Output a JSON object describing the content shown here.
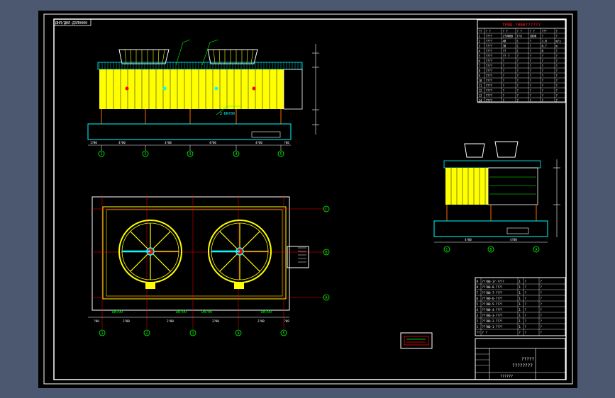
{
  "drawing": {
    "title_tag": "ДНЛ/ДНЛ-ДЗЛ0000",
    "colors": {
      "frame_bg": "#4c5870",
      "canvas_bg": "#000000",
      "fill": "#ffff00",
      "line": "#ffffff",
      "accent_cyan": "#00ffff",
      "accent_green": "#00ff00",
      "accent_red": "#ff0000",
      "accent_magenta": "#ff00ff"
    }
  },
  "spec_table": {
    "title": "TFNG-?000??????",
    "rows": [
      [
        "??",
        "? ?",
        "? ?",
        "? ?",
        "? ?",
        "???",
        "?"
      ],
      [
        "1",
        "????",
        "2?0000",
        "T/h",
        "1800",
        "?",
        "?"
      ],
      [
        "2",
        "????",
        "40",
        "C",
        "?",
        "3.8",
        "m/s"
      ],
      [
        "3",
        "????",
        "30",
        "C",
        "?",
        "0.?",
        "m"
      ],
      [
        "4",
        "????",
        "??",
        "C",
        "?",
        "0",
        "?"
      ],
      [
        "5",
        "????",
        "?? ?",
        "?",
        "?",
        "?",
        "?"
      ],
      [
        "6",
        "????",
        "?",
        "?",
        "?",
        "?",
        "?"
      ],
      [
        "7",
        "????",
        "?",
        "?",
        "?",
        "?",
        "?"
      ],
      [
        "8",
        "????",
        "?",
        "?",
        "?",
        "?",
        "?"
      ],
      [
        "9",
        "????",
        "?",
        "?",
        "?",
        "?",
        "?"
      ],
      [
        "10",
        "????",
        "?",
        "?",
        "?",
        "?",
        "?"
      ],
      [
        "11",
        "????",
        "?",
        "?",
        "?",
        "?",
        "?"
      ],
      [
        "12",
        "????",
        "?",
        "?",
        "?",
        "?",
        "?"
      ],
      [
        "13",
        "????",
        "?",
        "?",
        "?",
        "?",
        "?"
      ],
      [
        "14",
        "????",
        "?",
        "?",
        "?",
        "?",
        "?"
      ]
    ]
  },
  "front_view": {
    "bottom_dims": [
      "1?00",
      "4?00",
      "4?00",
      "4?00",
      "4?00",
      "?00"
    ],
    "axis_labels": [
      "1",
      "2",
      "3",
      "4",
      "5"
    ],
    "leader_text": "2-DN?00"
  },
  "plan_view": {
    "pipe_labels": [
      "DN?00",
      "DN?00",
      "DN?00",
      "DN?00"
    ],
    "bottom_dims": [
      "?00",
      "2?00",
      "2?00",
      "2?00",
      "2?00",
      "?00"
    ],
    "axis_labels": [
      "1",
      "2",
      "3",
      "4",
      "5"
    ],
    "row_labels": [
      "C",
      "B",
      "A"
    ]
  },
  "side_view": {
    "axis_labels": [
      "C",
      "B",
      "A"
    ],
    "dims": [
      "4?00",
      "4?00"
    ]
  },
  "parts_list": {
    "rows": [
      [
        "9",
        "???00-1?-????",
        "1",
        "?",
        "?"
      ],
      [
        "8",
        "???00-8-????",
        "1",
        "?",
        "?"
      ],
      [
        "7",
        "???00-7-????",
        "1",
        "?",
        "?"
      ],
      [
        "6",
        "???00-6-????",
        "1",
        "?",
        "?"
      ],
      [
        "5",
        "???00-5-????",
        "1",
        "?",
        "?"
      ],
      [
        "4",
        "???00-4-????",
        "1",
        "?",
        "?"
      ],
      [
        "3",
        "???00-3-????",
        "1",
        "?",
        "?"
      ],
      [
        "2",
        "???00-2-????",
        "1",
        "?",
        "?"
      ],
      [
        "1",
        "???00-1-????",
        "1",
        "?",
        "?"
      ],
      [
        "??",
        "? ?",
        "?",
        "?",
        "?"
      ]
    ]
  },
  "title_block": {
    "line1": "?????",
    "line2": "????????",
    "footer": "??????"
  }
}
